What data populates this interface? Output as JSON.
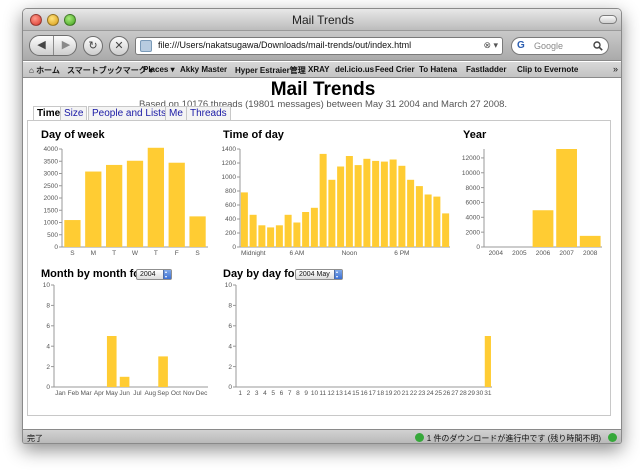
{
  "window": {
    "title": "Mail Trends"
  },
  "nav": {
    "back_glyph": "◀",
    "forward_glyph": "▶",
    "reload_glyph": "↻",
    "stop_glyph": "✕",
    "url": "file:///Users/nakatsugawa/Downloads/mail-trends/out/index.html",
    "url_actions": "⊗ ▾",
    "search_placeholder": "Google",
    "google_glyph": "G"
  },
  "bookmarks": {
    "items": [
      "ホーム",
      "スマートブックマーク ▾",
      "Places ▾",
      "Akky Master",
      "Hyper Estraier管理",
      "XRAY",
      "del.icio.us",
      "Feed Crier",
      "To Hatena",
      "Fastladder",
      "Clip to Evernote"
    ],
    "more": "»"
  },
  "page": {
    "title": "Mail Trends",
    "subtitle": "Based on 10176 threads (19801 messages) between May 31 2004 and March 27 2008.",
    "tabs": [
      "Time",
      "Size",
      "People and Lists",
      "Me",
      "Threads"
    ],
    "active_tab": "Time"
  },
  "sections": {
    "day_of_week": "Day of week",
    "time_of_day": "Time of day",
    "year": "Year",
    "month_by_month": "Month by month for",
    "day_by_day": "Day by day for",
    "month_select": "2004",
    "day_select": "2004 May"
  },
  "status": {
    "left": "完了",
    "right": "1 件のダウンロードが進行中です (残り時間不明)"
  },
  "colors": {
    "bar": "#ffcc33",
    "axis": "#999999",
    "tick_text": "#555555",
    "link": "#1a1aa6"
  },
  "chart_data": [
    {
      "type": "bar",
      "title": "Day of week",
      "categories": [
        "S",
        "M",
        "T",
        "W",
        "T",
        "F",
        "S"
      ],
      "values": [
        1100,
        3080,
        3350,
        3520,
        4050,
        3440,
        1250
      ],
      "ylim": [
        0,
        4000
      ],
      "yticks": [
        0,
        500,
        1000,
        1500,
        2000,
        2500,
        3000,
        3500,
        4000
      ],
      "grid": false
    },
    {
      "type": "bar",
      "title": "Time of day",
      "categories": [
        "0",
        "1",
        "2",
        "3",
        "4",
        "5",
        "6",
        "7",
        "8",
        "9",
        "10",
        "11",
        "12",
        "13",
        "14",
        "15",
        "16",
        "17",
        "18",
        "19",
        "20",
        "21",
        "22",
        "23"
      ],
      "xticklabels": [
        {
          "index": 0,
          "label": "Midnight"
        },
        {
          "index": 6,
          "label": "6 AM"
        },
        {
          "index": 12,
          "label": "Noon"
        },
        {
          "index": 18,
          "label": "6 PM"
        }
      ],
      "values": [
        780,
        460,
        310,
        280,
        310,
        460,
        350,
        500,
        560,
        1330,
        960,
        1150,
        1300,
        1170,
        1260,
        1230,
        1220,
        1250,
        1160,
        960,
        870,
        750,
        720,
        480
      ],
      "ylim": [
        0,
        1400
      ],
      "yticks": [
        0,
        200,
        400,
        600,
        800,
        1000,
        1200,
        1400
      ],
      "grid": false
    },
    {
      "type": "bar",
      "title": "Year",
      "categories": [
        "2004",
        "2005",
        "2006",
        "2007",
        "2008"
      ],
      "values": [
        0,
        0,
        4950,
        13200,
        1500
      ],
      "ylim": [
        0,
        13200
      ],
      "yticks": [
        0,
        2000,
        4000,
        6000,
        8000,
        10000,
        12000
      ],
      "grid": false
    },
    {
      "type": "bar",
      "title": "Month by month for 2004",
      "categories": [
        "Jan",
        "Feb",
        "Mar",
        "Apr",
        "May",
        "Jun",
        "Jul",
        "Aug",
        "Sep",
        "Oct",
        "Nov",
        "Dec"
      ],
      "values": [
        0,
        0,
        0,
        0,
        5,
        1,
        0,
        0,
        3,
        0,
        0,
        0
      ],
      "ylim": [
        0,
        10
      ],
      "yticks": [
        0,
        2,
        4,
        6,
        8,
        10
      ],
      "grid": false
    },
    {
      "type": "bar",
      "title": "Day by day for 2004 May",
      "categories": [
        "1",
        "2",
        "3",
        "4",
        "5",
        "6",
        "7",
        "8",
        "9",
        "10",
        "11",
        "12",
        "13",
        "14",
        "15",
        "16",
        "17",
        "18",
        "19",
        "20",
        "21",
        "22",
        "23",
        "24",
        "25",
        "26",
        "27",
        "28",
        "29",
        "30",
        "31"
      ],
      "values": [
        0,
        0,
        0,
        0,
        0,
        0,
        0,
        0,
        0,
        0,
        0,
        0,
        0,
        0,
        0,
        0,
        0,
        0,
        0,
        0,
        0,
        0,
        0,
        0,
        0,
        0,
        0,
        0,
        0,
        0,
        5
      ],
      "ylim": [
        0,
        10
      ],
      "yticks": [
        0,
        2,
        4,
        6,
        8,
        10
      ],
      "grid": false
    }
  ]
}
